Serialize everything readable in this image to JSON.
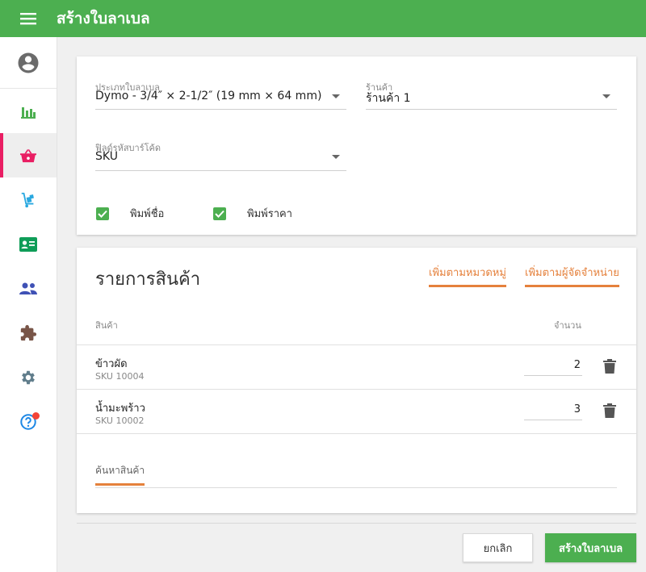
{
  "appbar": {
    "title": "สร้างใบลาเบล"
  },
  "sidebar": {
    "items": [
      {
        "icon": "bar-chart-icon"
      },
      {
        "icon": "basket-icon"
      },
      {
        "icon": "hand-truck-icon"
      },
      {
        "icon": "contact-card-icon"
      },
      {
        "icon": "people-icon"
      },
      {
        "icon": "puzzle-icon"
      },
      {
        "icon": "gear-icon"
      },
      {
        "icon": "help-icon"
      }
    ]
  },
  "form": {
    "label_type": {
      "label": "ประเภทใบลาเบล",
      "value": "Dymo - 3/4″ × 2-1/2″ (19 mm × 64 mm)"
    },
    "store": {
      "label": "ร้านค้า",
      "value": "ร้านค้า 1"
    },
    "barcode": {
      "label": "ฟิลด์รหัสบาร์โค้ด",
      "value": "SKU"
    },
    "print_name": {
      "label": "พิมพ์ชื่อ",
      "checked": true
    },
    "print_price": {
      "label": "พิมพ์ราคา",
      "checked": true
    }
  },
  "products": {
    "title": "รายการสินค้า",
    "add_by_category": "เพิ่มตามหมวดหมู่",
    "add_by_supplier": "เพิ่มตามผู้จัดจำหน่าย",
    "col_product": "สินค้า",
    "col_qty": "จำนวน",
    "rows": [
      {
        "name": "ข้าวผัด",
        "sku": "SKU 10004",
        "qty": "2"
      },
      {
        "name": "น้ำมะพร้าว",
        "sku": "SKU 10002",
        "qty": "3"
      }
    ],
    "search_placeholder": "ค้นหาสินค้า"
  },
  "actions": {
    "cancel": "ยกเลิก",
    "create": "สร้างใบลาเบล"
  },
  "colors": {
    "primary": "#4caf50",
    "accent": "#e5813c",
    "active_marker": "#e91e63"
  }
}
